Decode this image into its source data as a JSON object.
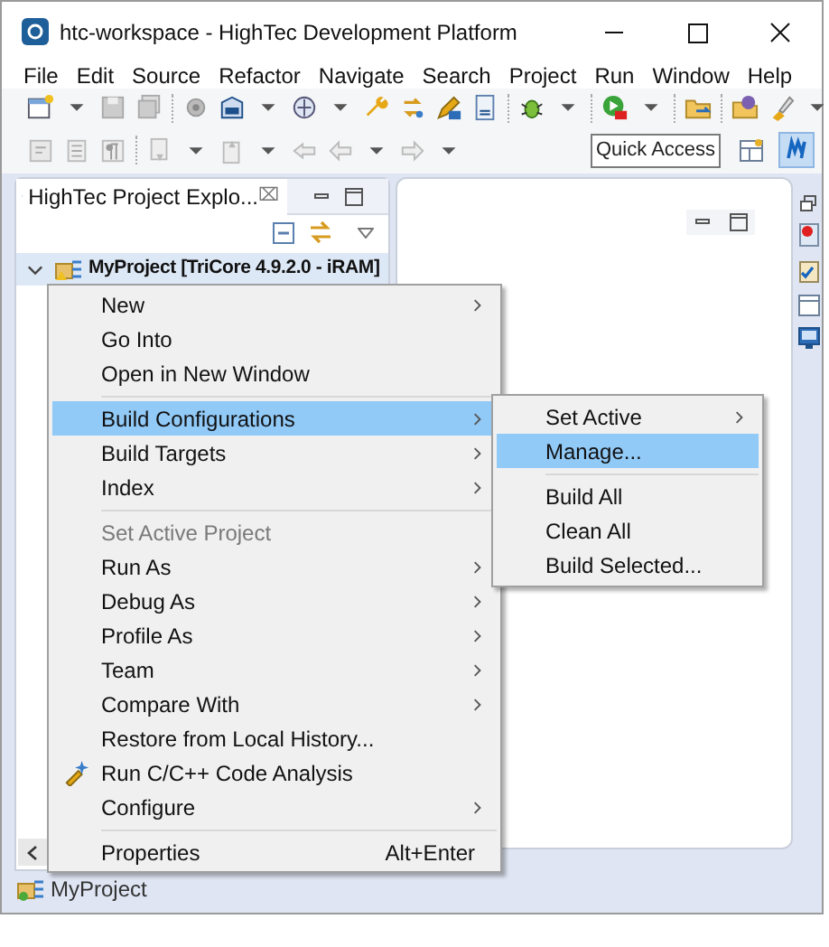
{
  "window": {
    "title": "htc-workspace - HighTec Development Platform"
  },
  "menu_bar": [
    "File",
    "Edit",
    "Source",
    "Refactor",
    "Navigate",
    "Search",
    "Project",
    "Run",
    "Window",
    "Help"
  ],
  "quick_access": {
    "placeholder": "Quick Access"
  },
  "explorer": {
    "title": "HighTec Project Explo...",
    "close": "⌧",
    "tree": [
      {
        "label": "MyProject [TriCore 4.9.2.0 - iRAM]",
        "expanded": true,
        "selected": true
      }
    ],
    "status": "MyProject"
  },
  "context_menu": [
    {
      "kind": "item",
      "label": "New",
      "submenu": true,
      "selected": false,
      "disabled": false
    },
    {
      "kind": "item",
      "label": "Go Into",
      "submenu": false,
      "selected": false,
      "disabled": false
    },
    {
      "kind": "item",
      "label": "Open in New Window",
      "submenu": false,
      "selected": false,
      "disabled": false
    },
    {
      "kind": "separator"
    },
    {
      "kind": "item",
      "label": "Build Configurations",
      "submenu": true,
      "selected": true,
      "disabled": false
    },
    {
      "kind": "item",
      "label": "Build Targets",
      "submenu": true,
      "selected": false,
      "disabled": false
    },
    {
      "kind": "item",
      "label": "Index",
      "submenu": true,
      "selected": false,
      "disabled": false
    },
    {
      "kind": "separator"
    },
    {
      "kind": "item",
      "label": "Set Active Project",
      "submenu": false,
      "selected": false,
      "disabled": true
    },
    {
      "kind": "item",
      "label": "Run As",
      "submenu": true,
      "selected": false,
      "disabled": false
    },
    {
      "kind": "item",
      "label": "Debug As",
      "submenu": true,
      "selected": false,
      "disabled": false
    },
    {
      "kind": "item",
      "label": "Profile As",
      "submenu": true,
      "selected": false,
      "disabled": false
    },
    {
      "kind": "item",
      "label": "Team",
      "submenu": true,
      "selected": false,
      "disabled": false
    },
    {
      "kind": "item",
      "label": "Compare With",
      "submenu": true,
      "selected": false,
      "disabled": false
    },
    {
      "kind": "item",
      "label": "Restore from Local History...",
      "submenu": false,
      "selected": false,
      "disabled": false
    },
    {
      "kind": "item",
      "label": "Run C/C++ Code Analysis",
      "submenu": false,
      "selected": false,
      "disabled": false,
      "icon": true
    },
    {
      "kind": "item",
      "label": "Configure",
      "submenu": true,
      "selected": false,
      "disabled": false
    },
    {
      "kind": "separator"
    },
    {
      "kind": "item",
      "label": "Properties",
      "submenu": false,
      "selected": false,
      "disabled": false,
      "shortcut": "Alt+Enter"
    }
  ],
  "submenu": [
    {
      "kind": "item",
      "label": "Set Active",
      "submenu": true,
      "selected": false
    },
    {
      "kind": "item",
      "label": "Manage...",
      "submenu": false,
      "selected": true
    },
    {
      "kind": "separator"
    },
    {
      "kind": "item",
      "label": "Build All",
      "submenu": false,
      "selected": false
    },
    {
      "kind": "item",
      "label": "Clean All",
      "submenu": false,
      "selected": false
    },
    {
      "kind": "item",
      "label": "Build Selected...",
      "submenu": false,
      "selected": false
    }
  ]
}
